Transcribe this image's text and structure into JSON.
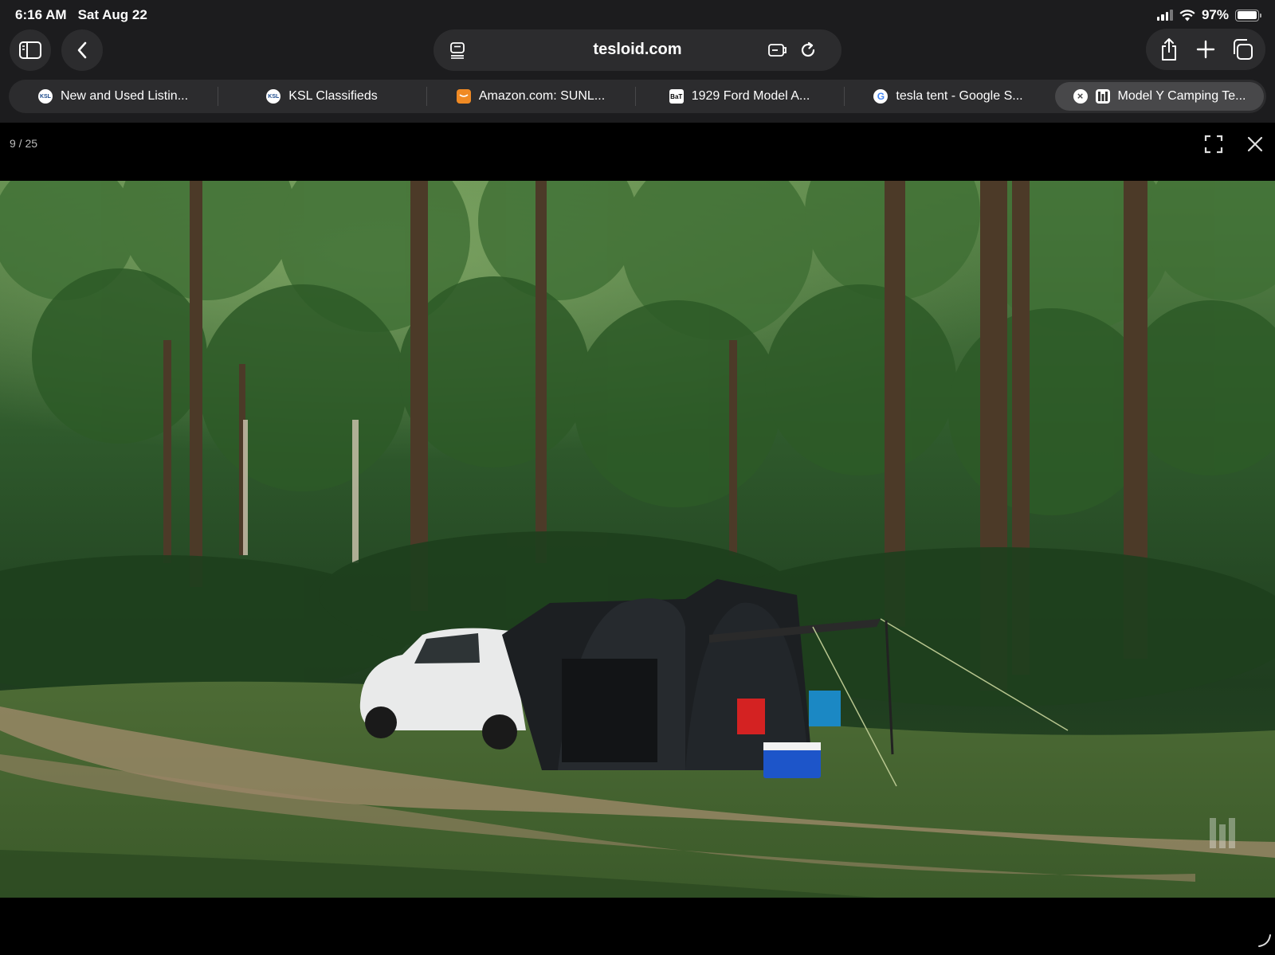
{
  "status_bar": {
    "time": "6:16 AM",
    "date": "Sat Aug 22",
    "battery": "97%",
    "battery_level": 0.97
  },
  "browser": {
    "address": "tesloid.com",
    "icons": {
      "sidebar": "sidebar-icon",
      "back": "chevron-left-icon",
      "page_menu": "page-menu-icon",
      "extension": "extension-icon",
      "reload": "reload-icon",
      "share": "share-icon",
      "new_tab": "plus-icon",
      "tabs": "tabs-overview-icon"
    },
    "tabs": [
      {
        "label": "New and Used Listin...",
        "favicon": "KSL",
        "active": false
      },
      {
        "label": "KSL Classifieds",
        "favicon": "KSL",
        "active": false
      },
      {
        "label": "Amazon.com: SUNL...",
        "favicon": "",
        "active": false
      },
      {
        "label": "1929 Ford Model A...",
        "favicon": "BaT",
        "active": false
      },
      {
        "label": "tesla tent - Google S...",
        "favicon": "G",
        "active": false
      },
      {
        "label": "Model Y Camping Te...",
        "favicon": "",
        "active": true
      }
    ]
  },
  "viewer": {
    "counter": "9 / 25",
    "image_alt": "White Tesla Model Y with a black tent attached in a forest clearing, with red and blue camp chairs and a blue cooler"
  },
  "colors": {
    "chrome_bg": "#1c1c1e",
    "control_bg": "#2c2c2e",
    "active_tab": "#48484a",
    "viewer_bg": "#000000"
  }
}
